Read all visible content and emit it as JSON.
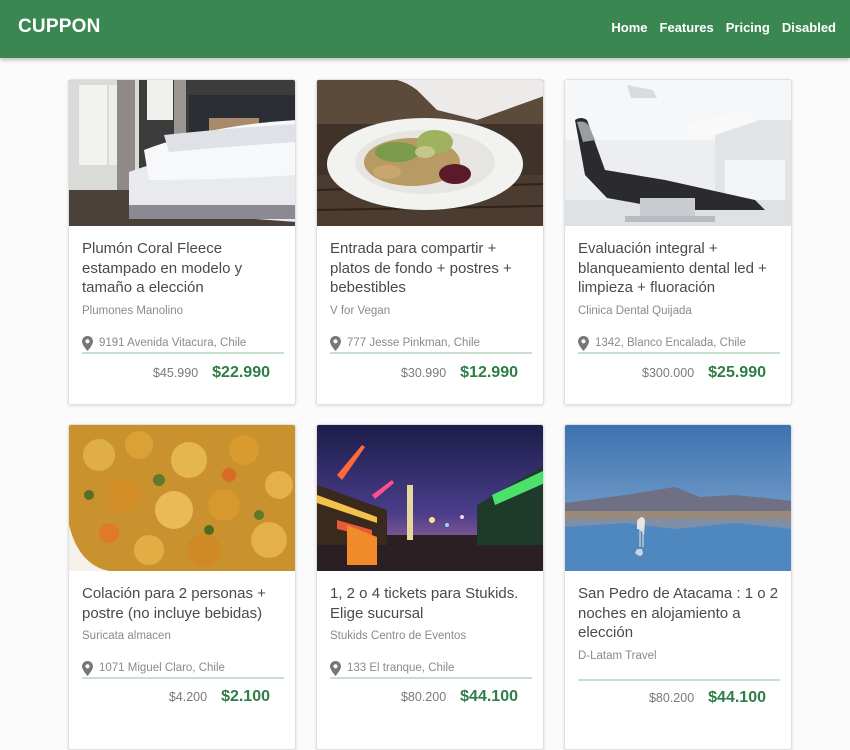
{
  "brand": "CUPPON",
  "nav": [
    "Home",
    "Features",
    "Pricing",
    "Disabled"
  ],
  "cards": [
    {
      "title": "Plumón Coral Fleece estampado en modelo y tamaño a elección",
      "vendor": "Plumones Manolino",
      "location": "9191 Avenida Vitacura, Chile",
      "old_price": "$45.990",
      "new_price": "$22.990",
      "image": "bedroom-photo"
    },
    {
      "title": "Entrada para compartir + platos de fondo + postres + bebestibles",
      "vendor": "V for Vegan",
      "location": "777 Jesse Pinkman, Chile",
      "old_price": "$30.990",
      "new_price": "$12.990",
      "image": "salad-plate-photo"
    },
    {
      "title": "Evaluación integral + blanqueamiento dental led + limpieza + fluoración",
      "vendor": "Clinica Dental Quijada",
      "location": "1342, Blanco Encalada, Chile",
      "old_price": "$300.000",
      "new_price": "$25.990",
      "image": "dental-chair-photo"
    },
    {
      "title": "Colación para 2 personas + postre (no incluye bebidas)",
      "vendor": "Suricata almacen",
      "location": "1071 Miguel Claro, Chile",
      "old_price": "$4.200",
      "new_price": "$2.100",
      "image": "curry-food-photo"
    },
    {
      "title": "1, 2 o 4 tickets para Stukids. Elige sucursal",
      "vendor": "Stukids Centro de Eventos",
      "location": "133 El tranque, Chile",
      "old_price": "$80.200",
      "new_price": "$44.100",
      "image": "fairground-night-photo"
    },
    {
      "title": "San Pedro de Atacama : 1 o 2 noches en alojamiento a elección",
      "vendor": "D-Latam Travel",
      "location": "",
      "old_price": "$80.200",
      "new_price": "$44.100",
      "image": "lake-flamingo-photo"
    }
  ],
  "colors": {
    "navbar": "#3b8752",
    "price": "#2f7d47",
    "location_rule": "#c7ded0"
  }
}
